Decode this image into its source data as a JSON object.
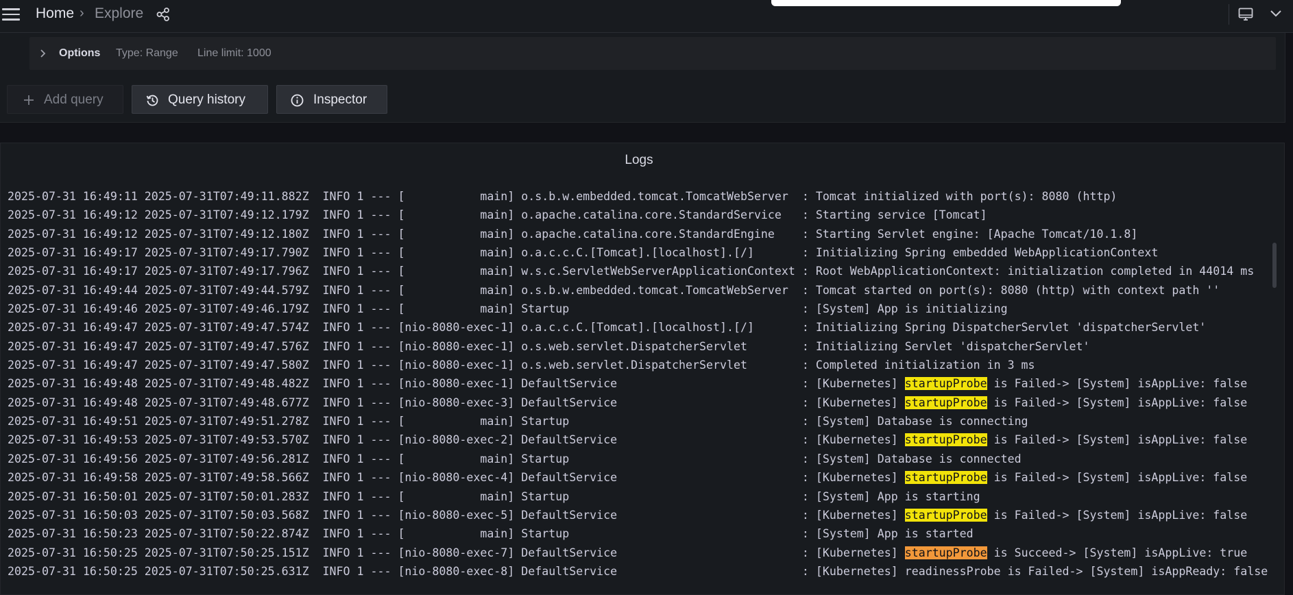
{
  "topbar": {
    "breadcrumb_home": "Home",
    "breadcrumb_separator": "›",
    "breadcrumb_explore": "Explore",
    "icons": [
      "menu-icon",
      "share-icon",
      "monitor-icon",
      "chevron-down-icon"
    ]
  },
  "query": {
    "options_label": "Options",
    "options_type": "Type: Range",
    "options_line_limit": "Line limit: 1000",
    "add_query_label": "Add query",
    "query_history_label": "Query history",
    "inspector_label": "Inspector"
  },
  "logs": {
    "title": "Logs",
    "highlight_colors": {
      "failed": "#f2e30a",
      "succeed": "#f2983a"
    },
    "lines": [
      {
        "pre": "2025-07-31 16:49:11 2025-07-31T07:49:11.882Z  INFO 1 --- [           main] o.s.b.w.embedded.tomcat.TomcatWebServer  : Tomcat initialized with port(s): 8080 (http)"
      },
      {
        "pre": "2025-07-31 16:49:12 2025-07-31T07:49:12.179Z  INFO 1 --- [           main] o.apache.catalina.core.StandardService   : Starting service [Tomcat]"
      },
      {
        "pre": "2025-07-31 16:49:12 2025-07-31T07:49:12.180Z  INFO 1 --- [           main] o.apache.catalina.core.StandardEngine    : Starting Servlet engine: [Apache Tomcat/10.1.8]"
      },
      {
        "pre": "2025-07-31 16:49:17 2025-07-31T07:49:17.790Z  INFO 1 --- [           main] o.a.c.c.C.[Tomcat].[localhost].[/]       : Initializing Spring embedded WebApplicationContext"
      },
      {
        "pre": "2025-07-31 16:49:17 2025-07-31T07:49:17.796Z  INFO 1 --- [           main] w.s.c.ServletWebServerApplicationContext : Root WebApplicationContext: initialization completed in 44014 ms"
      },
      {
        "pre": "2025-07-31 16:49:44 2025-07-31T07:49:44.579Z  INFO 1 --- [           main] o.s.b.w.embedded.tomcat.TomcatWebServer  : Tomcat started on port(s): 8080 (http) with context path ''"
      },
      {
        "pre": "2025-07-31 16:49:46 2025-07-31T07:49:46.179Z  INFO 1 --- [           main] Startup                                  : [System] App is initializing"
      },
      {
        "pre": "2025-07-31 16:49:47 2025-07-31T07:49:47.574Z  INFO 1 --- [nio-8080-exec-1] o.a.c.c.C.[Tomcat].[localhost].[/]       : Initializing Spring DispatcherServlet 'dispatcherServlet'"
      },
      {
        "pre": "2025-07-31 16:49:47 2025-07-31T07:49:47.576Z  INFO 1 --- [nio-8080-exec-1] o.s.web.servlet.DispatcherServlet        : Initializing Servlet 'dispatcherServlet'"
      },
      {
        "pre": "2025-07-31 16:49:47 2025-07-31T07:49:47.580Z  INFO 1 --- [nio-8080-exec-1] o.s.web.servlet.DispatcherServlet        : Completed initialization in 3 ms"
      },
      {
        "pre": "2025-07-31 16:49:48 2025-07-31T07:49:48.482Z  INFO 1 --- [nio-8080-exec-1] DefaultService                           : [Kubernetes] ",
        "hl": "startupProbe",
        "hl_kind": "failed",
        "post": " is Failed-> [System] isAppLive: false"
      },
      {
        "pre": "2025-07-31 16:49:48 2025-07-31T07:49:48.677Z  INFO 1 --- [nio-8080-exec-3] DefaultService                           : [Kubernetes] ",
        "hl": "startupProbe",
        "hl_kind": "failed",
        "post": " is Failed-> [System] isAppLive: false"
      },
      {
        "pre": "2025-07-31 16:49:51 2025-07-31T07:49:51.278Z  INFO 1 --- [           main] Startup                                  : [System] Database is connecting"
      },
      {
        "pre": "2025-07-31 16:49:53 2025-07-31T07:49:53.570Z  INFO 1 --- [nio-8080-exec-2] DefaultService                           : [Kubernetes] ",
        "hl": "startupProbe",
        "hl_kind": "failed",
        "post": " is Failed-> [System] isAppLive: false"
      },
      {
        "pre": "2025-07-31 16:49:56 2025-07-31T07:49:56.281Z  INFO 1 --- [           main] Startup                                  : [System] Database is connected"
      },
      {
        "pre": "2025-07-31 16:49:58 2025-07-31T07:49:58.566Z  INFO 1 --- [nio-8080-exec-4] DefaultService                           : [Kubernetes] ",
        "hl": "startupProbe",
        "hl_kind": "failed",
        "post": " is Failed-> [System] isAppLive: false"
      },
      {
        "pre": "2025-07-31 16:50:01 2025-07-31T07:50:01.283Z  INFO 1 --- [           main] Startup                                  : [System] App is starting"
      },
      {
        "pre": "2025-07-31 16:50:03 2025-07-31T07:50:03.568Z  INFO 1 --- [nio-8080-exec-5] DefaultService                           : [Kubernetes] ",
        "hl": "startupProbe",
        "hl_kind": "failed",
        "post": " is Failed-> [System] isAppLive: false"
      },
      {
        "pre": "2025-07-31 16:50:23 2025-07-31T07:50:22.874Z  INFO 1 --- [           main] Startup                                  : [System] App is started"
      },
      {
        "pre": "2025-07-31 16:50:25 2025-07-31T07:50:25.151Z  INFO 1 --- [nio-8080-exec-7] DefaultService                           : [Kubernetes] ",
        "hl": "startupProbe",
        "hl_kind": "succeed",
        "post": " is Succeed-> [System] isAppLive: true"
      },
      {
        "pre": "2025-07-31 16:50:25 2025-07-31T07:50:25.631Z  INFO 1 --- [nio-8080-exec-8] DefaultService                           : [Kubernetes] readinessProbe is Failed-> [System] isAppReady: false"
      }
    ]
  }
}
